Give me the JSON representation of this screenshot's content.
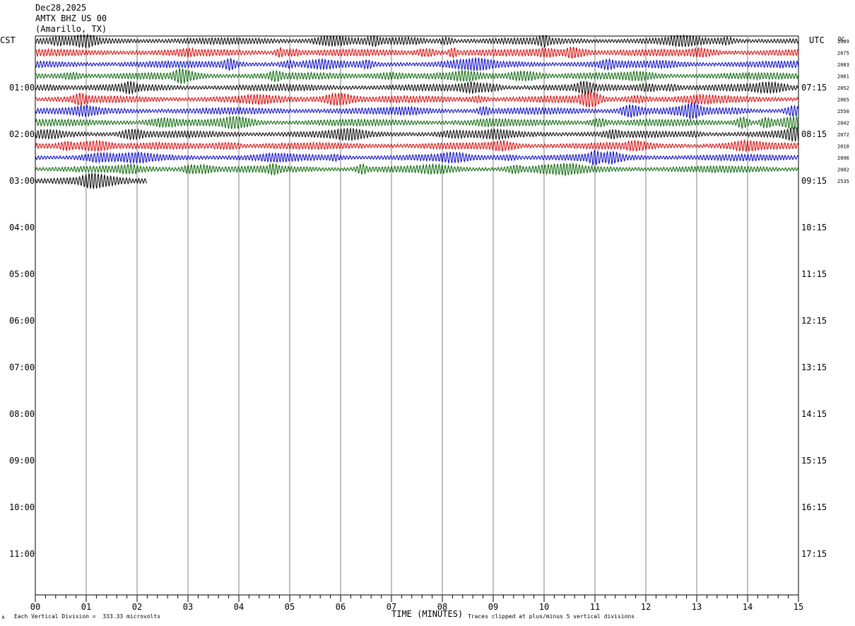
{
  "header": {
    "date": "Dec28,2025",
    "station": "AMTX BHZ US 00",
    "location": "(Amarillo, TX)"
  },
  "left_zone_label": "CST",
  "right_zone_label": "UTC",
  "dc_label": "DC",
  "footer": {
    "division_note": "Each Vertical Division =  333.33 microvolts",
    "clip_note": "Traces clipped at plus/minus 5 vertical divisions",
    "corner_mark": "∧"
  },
  "colors": {
    "trace_cycle": [
      "#000000",
      "#e00000",
      "#0000cc",
      "#006400"
    ],
    "grid_line": "#808080",
    "background": "#ffffff"
  },
  "chart_data": {
    "type": "line",
    "title": "Dec28,2025 AMTX BHZ US 00 (Amarillo, TX)",
    "xlabel": "TIME (MINUTES)",
    "ylabel": "",
    "xlim": [
      0,
      15
    ],
    "x_ticks": [
      "00",
      "01",
      "02",
      "03",
      "04",
      "05",
      "06",
      "07",
      "08",
      "09",
      "10",
      "11",
      "12",
      "13",
      "14",
      "15"
    ],
    "grid": true,
    "rows_per_hour": 4,
    "minutes_per_row": 15,
    "left_hour_labels": [
      "01:00",
      "02:00",
      "03:00",
      "04:00",
      "05:00",
      "06:00",
      "07:00",
      "08:00",
      "09:00",
      "10:00",
      "11:00"
    ],
    "right_hour_labels": [
      "07:15",
      "08:15",
      "09:15",
      "10:15",
      "11:15",
      "12:15",
      "13:15",
      "14:15",
      "15:15",
      "16:15",
      "17:15"
    ],
    "traces": [
      {
        "row": 0,
        "dc": "2089",
        "minutes": 15
      },
      {
        "row": 1,
        "dc": "2075",
        "minutes": 15
      },
      {
        "row": 2,
        "dc": "2083",
        "minutes": 15
      },
      {
        "row": 3,
        "dc": "2061",
        "minutes": 15
      },
      {
        "row": 4,
        "dc": "2052",
        "minutes": 15
      },
      {
        "row": 5,
        "dc": "2065",
        "minutes": 15
      },
      {
        "row": 6,
        "dc": "2550",
        "minutes": 15
      },
      {
        "row": 7,
        "dc": "2042",
        "minutes": 15
      },
      {
        "row": 8,
        "dc": "2072",
        "minutes": 15
      },
      {
        "row": 9,
        "dc": "2010",
        "minutes": 15
      },
      {
        "row": 10,
        "dc": "2096",
        "minutes": 15
      },
      {
        "row": 11,
        "dc": "2002",
        "minutes": 15
      },
      {
        "row": 12,
        "dc": "2535",
        "minutes": 2.2
      }
    ]
  }
}
